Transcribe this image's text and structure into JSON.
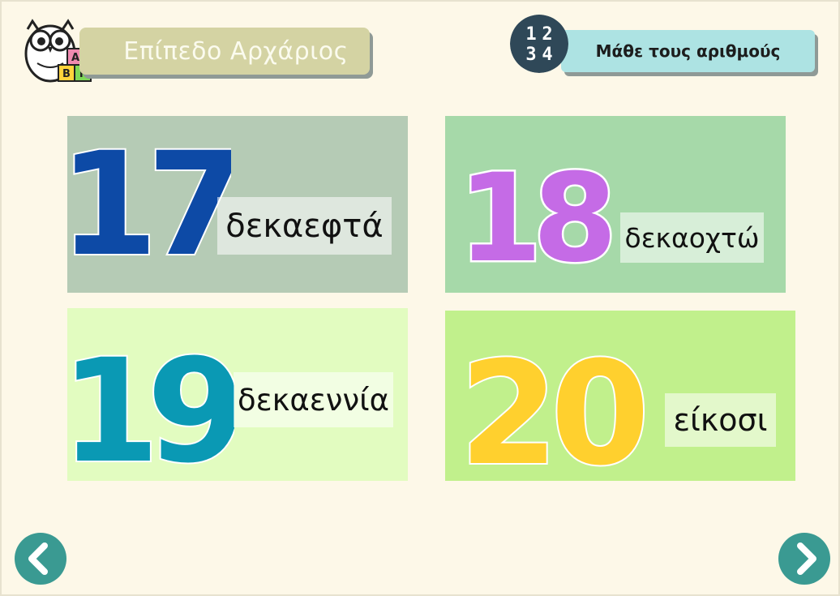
{
  "header": {
    "level_label": "Επίπεδο Αρχάριος",
    "topic_label": "Μάθε τους αριθμούς",
    "badge_digits": [
      "1",
      "2",
      "3",
      "4"
    ],
    "logo_blocks": [
      "Α",
      "Β",
      "Γ"
    ]
  },
  "cards": [
    {
      "number": "17",
      "word": "δεκαεφτά",
      "bg": "#b5cbb5",
      "digit_color": "#0d4aa6"
    },
    {
      "number": "18",
      "word": "δεκαοχτώ",
      "bg": "#a6d9a9",
      "digit_color": "#c56be6"
    },
    {
      "number": "19",
      "word": "δεκαεννία",
      "bg": "#e2fcc0",
      "digit_color": "#0a99b4"
    },
    {
      "number": "20",
      "word": "είκοσι",
      "bg": "#c1f08c",
      "digit_color": "#ffd02e"
    }
  ],
  "navigation": {
    "prev_icon": "chevron-left-icon",
    "next_icon": "chevron-right-icon"
  },
  "colors": {
    "page_bg": "#fdf8e8",
    "level_banner": "#d4d3a3",
    "topic_banner": "#ade3e3",
    "badge": "#2f4858",
    "nav_button": "#3a9a92"
  }
}
